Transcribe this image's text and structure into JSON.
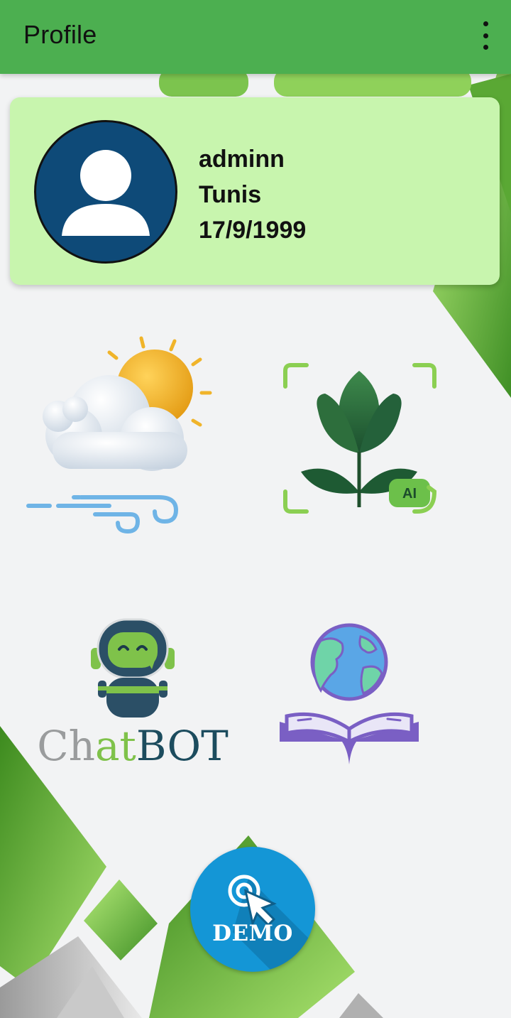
{
  "appbar": {
    "title": "Profile",
    "menu_icon": "more-vert-icon"
  },
  "profile": {
    "username": "adminn",
    "city": "Tunis",
    "birthdate": "17/9/1999",
    "avatar_icon": "person-avatar-icon"
  },
  "tiles": {
    "weather": {
      "icon": "weather-icon"
    },
    "plant_ai": {
      "icon": "plant-ai-scan-icon",
      "badge": "AI"
    },
    "chatbot": {
      "icon": "chatbot-robot-icon",
      "text_part1": "Chat",
      "text_part2": "at",
      "text_part3": "BOT"
    },
    "education": {
      "icon": "globe-book-icon"
    }
  },
  "demo": {
    "label": "DEMO",
    "icon": "click-cursor-icon"
  },
  "colors": {
    "appbar": "#4caf50",
    "card": "#c8f5ae",
    "demo": "#1496d6",
    "background": "#f2f3f4"
  }
}
